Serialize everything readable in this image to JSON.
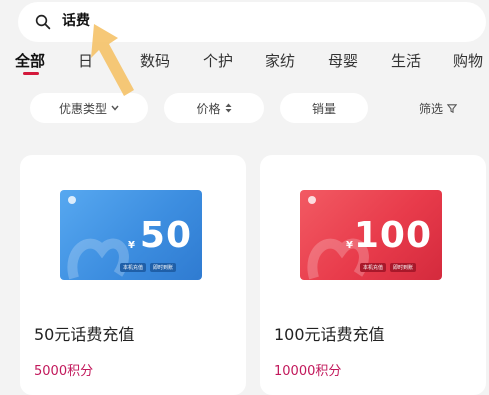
{
  "search": {
    "query": "话费"
  },
  "tabs": [
    {
      "label": "全部"
    },
    {
      "label": "日"
    },
    {
      "label": "数码"
    },
    {
      "label": "个护"
    },
    {
      "label": "家纺"
    },
    {
      "label": "母婴"
    },
    {
      "label": "生活"
    },
    {
      "label": "购物"
    }
  ],
  "filters": {
    "discount_type": "优惠类型",
    "price": "价格",
    "sales": "销量",
    "filter": "筛选"
  },
  "products": [
    {
      "title": "50元话费充值",
      "points": "5000积分",
      "card_amount": "50",
      "card_yen": "¥",
      "card_tag_1": "本机充值",
      "card_tag_2": "即时到账",
      "card_color": "#3d8ee0"
    },
    {
      "title": "100元话费充值",
      "points": "10000积分",
      "card_amount": "100",
      "card_yen": "¥",
      "card_tag_1": "本机充值",
      "card_tag_2": "即时到账",
      "card_color": "#e83b4b"
    }
  ],
  "colors": {
    "accent": "#d3183b",
    "points": "#c2185b",
    "arrow": "#f5c36b"
  }
}
